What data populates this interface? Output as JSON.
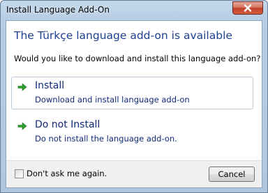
{
  "window": {
    "title": "Install Language Add-On"
  },
  "dialog": {
    "heading": "The Türkçe language add-on is available",
    "question": "Would you like to download and install this language add-on?"
  },
  "options": [
    {
      "label": "Install",
      "description": "Download and install language add-on",
      "icon": "green-arrow-icon"
    },
    {
      "label": "Do not Install",
      "description": "Do not install the language add-on.",
      "icon": "green-arrow-icon"
    }
  ],
  "footer": {
    "checkbox_label": "Don't ask me again.",
    "checkbox_checked": false,
    "cancel_label": "Cancel"
  },
  "colors": {
    "heading": "#1f3f8f",
    "link": "#102a7a",
    "arrow": "#2e9e2e",
    "close": "#c2402a"
  }
}
